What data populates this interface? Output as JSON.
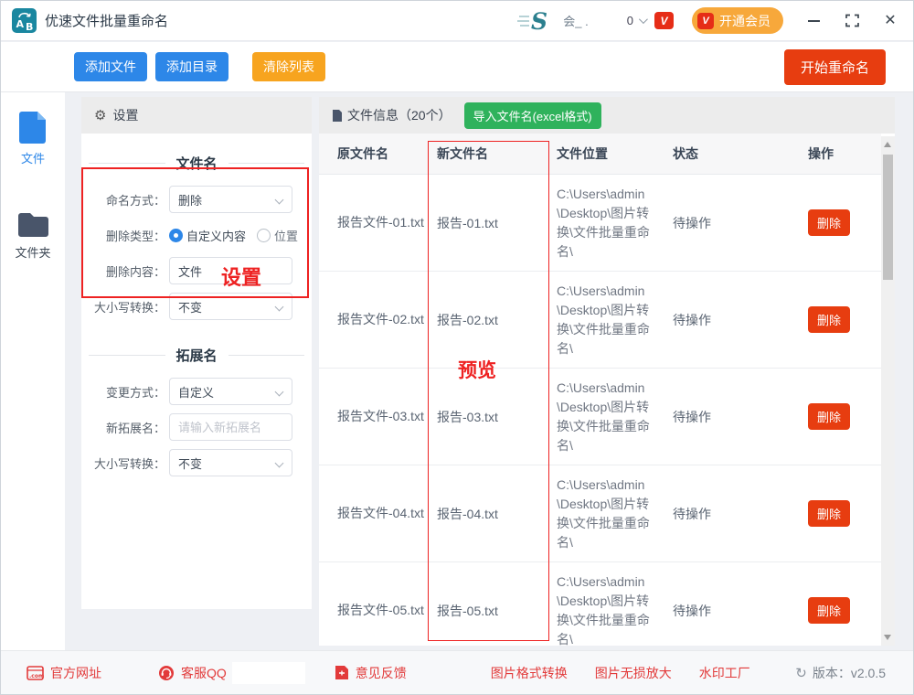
{
  "titlebar": {
    "app_title": "优速文件批量重命名",
    "account_text": "会_ .",
    "account_value": "0",
    "vip_badge": "V",
    "open_vip_label": "开通会员"
  },
  "toolbar": {
    "add_file_label": "添加文件",
    "add_directory_label": "添加目录",
    "clear_list_label": "清除列表",
    "start_rename_label": "开始重命名"
  },
  "sidebar": {
    "items": [
      {
        "label": "文件",
        "active": true
      },
      {
        "label": "文件夹",
        "active": false
      }
    ]
  },
  "settings": {
    "header_title": "设置",
    "annotation_label": "设置",
    "filename_section": {
      "title": "文件名",
      "naming_label": "命名方式：",
      "naming_value": "删除",
      "delete_type_label": "删除类型：",
      "radio_custom_label": "自定义内容",
      "radio_position_label": "位置",
      "delete_content_label": "删除内容：",
      "delete_content_value": "文件",
      "case_label": "大小写转换：",
      "case_value": "不变"
    },
    "extension_section": {
      "title": "拓展名",
      "change_label": "变更方式：",
      "change_value": "自定义",
      "new_ext_label": "新拓展名：",
      "new_ext_placeholder": "请输入新拓展名",
      "case_label": "大小写转换：",
      "case_value": "不变"
    }
  },
  "file_table": {
    "panel_title": "文件信息（20个）",
    "import_button_label": "导入文件名(excel格式)",
    "annotation_label": "预览",
    "columns": [
      "原文件名",
      "新文件名",
      "文件位置",
      "状态",
      "操作"
    ],
    "rows": [
      {
        "original": "报告文件-01.txt",
        "new_name": "报告-01.txt",
        "location": "C:\\Users\\admin\\Desktop\\图片转换\\文件批量重命名\\",
        "status": "待操作",
        "action": "删除"
      },
      {
        "original": "报告文件-02.txt",
        "new_name": "报告-02.txt",
        "location": "C:\\Users\\admin\\Desktop\\图片转换\\文件批量重命名\\",
        "status": "待操作",
        "action": "删除"
      },
      {
        "original": "报告文件-03.txt",
        "new_name": "报告-03.txt",
        "location": "C:\\Users\\admin\\Desktop\\图片转换\\文件批量重命名\\",
        "status": "待操作",
        "action": "删除"
      },
      {
        "original": "报告文件-04.txt",
        "new_name": "报告-04.txt",
        "location": "C:\\Users\\admin\\Desktop\\图片转换\\文件批量重命名\\",
        "status": "待操作",
        "action": "删除"
      },
      {
        "original": "报告文件-05.txt",
        "new_name": "报告-05.txt",
        "location": "C:\\Users\\admin\\Desktop\\图片转换\\文件批量重命名\\",
        "status": "待操作",
        "action": "删除"
      }
    ]
  },
  "footer": {
    "official_site": "官方网址",
    "customer_qq": "客服QQ",
    "feedback": "意见反馈",
    "links": [
      "图片格式转换",
      "图片无损放大",
      "水印工厂"
    ],
    "version": "版本：v2.0.5"
  },
  "colors": {
    "accent_blue": "#2d87e8",
    "accent_orange": "#f7a41f",
    "accent_red": "#e73d10",
    "accent_green": "#2fb25c",
    "vip_orange": "#f7a83b",
    "annotation_red": "#ee2222",
    "logo_teal": "#1a87a0"
  }
}
